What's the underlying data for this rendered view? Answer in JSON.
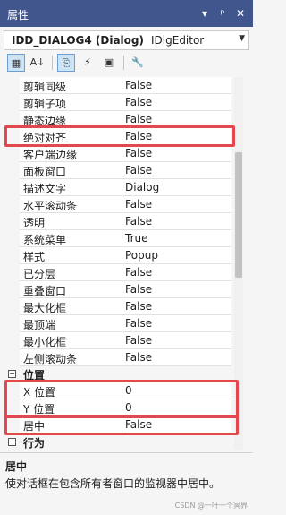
{
  "window": {
    "title": "属性",
    "controls": [
      "▾",
      "ᵖ",
      "✕"
    ]
  },
  "object_selector": {
    "name": "IDD_DIALOG4 (Dialog)",
    "type": "IDlgEditor",
    "dropdown_icon": "chevron-down-icon"
  },
  "toolbar": {
    "buttons": [
      {
        "icon": "categorized-icon",
        "glyph": "▦",
        "active": true
      },
      {
        "icon": "alphabetical-icon",
        "glyph": "A↓",
        "active": false
      },
      {
        "icon": "properties-icon",
        "glyph": "⎘",
        "active": true
      },
      {
        "icon": "events-icon",
        "glyph": "⚡",
        "active": false
      },
      {
        "icon": "messages-icon",
        "glyph": "▣",
        "active": false
      },
      {
        "icon": "property-pages-icon",
        "glyph": "🔧",
        "active": false
      }
    ]
  },
  "properties": [
    {
      "name": "剪辑同级",
      "value": "False"
    },
    {
      "name": "剪辑子项",
      "value": "False"
    },
    {
      "name": "静态边缘",
      "value": "False"
    },
    {
      "name": "绝对对齐",
      "value": "False"
    },
    {
      "name": "客户端边缘",
      "value": "False"
    },
    {
      "name": "面板窗口",
      "value": "False"
    },
    {
      "name": "描述文字",
      "value": "Dialog"
    },
    {
      "name": "水平滚动条",
      "value": "False"
    },
    {
      "name": "透明",
      "value": "False"
    },
    {
      "name": "系统菜单",
      "value": "True"
    },
    {
      "name": "样式",
      "value": "Popup"
    },
    {
      "name": "已分层",
      "value": "False"
    },
    {
      "name": "重叠窗口",
      "value": "False"
    },
    {
      "name": "最大化框",
      "value": "False"
    },
    {
      "name": "最顶端",
      "value": "False"
    },
    {
      "name": "最小化框",
      "value": "False"
    },
    {
      "name": "左侧滚动条",
      "value": "False"
    }
  ],
  "position_category": {
    "label": "位置",
    "toggle": "−",
    "items": [
      {
        "name": "X 位置",
        "value": "0"
      },
      {
        "name": "Y 位置",
        "value": "0"
      },
      {
        "name": "居中",
        "value": "False"
      }
    ]
  },
  "behavior_category": {
    "label": "行为",
    "toggle": "−"
  },
  "description": {
    "title": "居中",
    "text": "使对话框在包含所有者窗口的监视器中居中。"
  },
  "watermark": "CSDN @一叶一个冥界",
  "colors": {
    "titlebar": "#40568d",
    "highlight": "#e5474f"
  }
}
